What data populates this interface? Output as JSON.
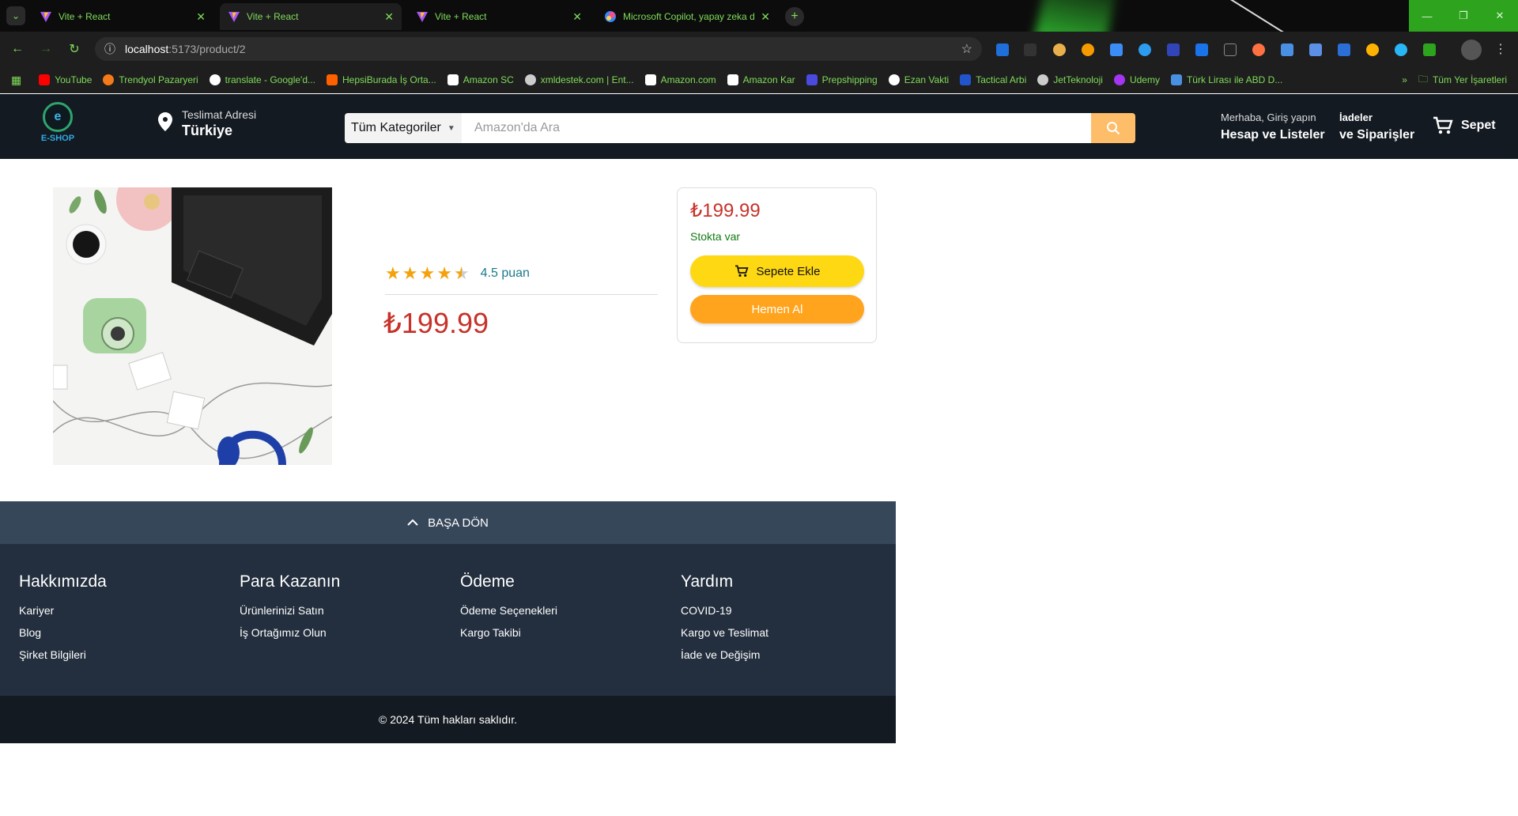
{
  "browser": {
    "tabs": [
      {
        "title": "Vite + React",
        "active": false
      },
      {
        "title": "Vite + React",
        "active": true
      },
      {
        "title": "Vite + React",
        "active": false
      },
      {
        "title": "Microsoft Copilot, yapay zeka destekli",
        "active": false
      }
    ],
    "url_host": "localhost",
    "url_path": ":5173/product/2",
    "bookmarks": [
      {
        "label": "YouTube",
        "color": "#ff0000"
      },
      {
        "label": "Trendyol Pazaryeri",
        "color": "#f27a1a"
      },
      {
        "label": "translate - Google'd...",
        "color": "#ffffff"
      },
      {
        "label": "HepsiBurada İş Orta...",
        "color": "#ff6000"
      },
      {
        "label": "Amazon SC",
        "color": "#ffffff"
      },
      {
        "label": "xmldestek.com | Ent...",
        "color": "#cccccc"
      },
      {
        "label": "Amazon.com",
        "color": "#ffffff"
      },
      {
        "label": "Amazon Kar",
        "color": "#ffffff"
      },
      {
        "label": "Prepshipping",
        "color": "#4a4adf"
      },
      {
        "label": "Ezan Vakti",
        "color": "#ffffff"
      },
      {
        "label": "Tactical Arbi",
        "color": "#2255cc"
      },
      {
        "label": "JetTeknoloji",
        "color": "#cccccc"
      },
      {
        "label": "Udemy",
        "color": "#a435f0"
      },
      {
        "label": "Türk Lirası ile ABD D...",
        "color": "#4a90e2"
      }
    ],
    "all_bookmarks": "Tüm Yer İşaretleri"
  },
  "header": {
    "logo_text": "E-SHOP",
    "deliver_label": "Teslimat Adresi",
    "deliver_country": "Türkiye",
    "search_category": "Tüm Kategoriler",
    "search_placeholder": "Amazon'da Ara",
    "account_line1": "Merhaba, Giriş yapın",
    "account_line2": "Hesap ve Listeler",
    "orders_line1": "İadeler",
    "orders_line2": "ve Siparişler",
    "cart_label": "Sepet"
  },
  "product": {
    "rating": 4.5,
    "rating_text": "4.5 puan",
    "price": "₺199.99",
    "box_price": "₺199.99",
    "stock": "Stokta var",
    "add_to_cart": "Sepete Ekle",
    "buy_now": "Hemen Al"
  },
  "footer": {
    "back_to_top": "BAŞA DÖN",
    "columns": [
      {
        "title": "Hakkımızda",
        "links": [
          "Kariyer",
          "Blog",
          "Şirket Bilgileri"
        ]
      },
      {
        "title": "Para Kazanın",
        "links": [
          "Ürünlerinizi Satın",
          "İş Ortağımız Olun"
        ]
      },
      {
        "title": "Ödeme",
        "links": [
          "Ödeme Seçenekleri",
          "Kargo Takibi"
        ]
      },
      {
        "title": "Yardım",
        "links": [
          "COVID-19",
          "Kargo ve Teslimat",
          "İade ve Değişim"
        ]
      }
    ],
    "copyright": "© 2024 Tüm hakları saklıdır."
  }
}
